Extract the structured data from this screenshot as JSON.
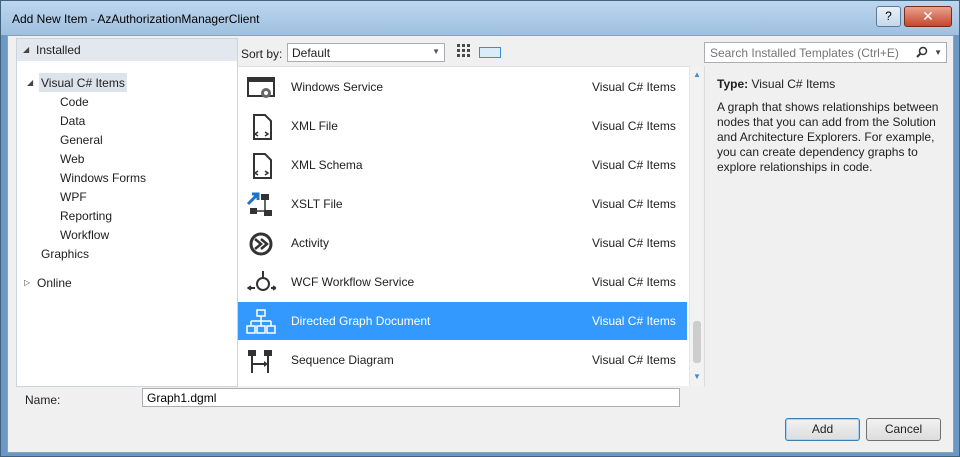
{
  "window": {
    "title": "Add New Item - AzAuthorizationManagerClient",
    "help_glyph": "?",
    "close_glyph": "✕"
  },
  "tree": {
    "installed": "Installed",
    "root": "Visual C# Items",
    "children": [
      "Code",
      "Data",
      "General",
      "Web",
      "Windows Forms",
      "WPF",
      "Reporting",
      "Workflow"
    ],
    "graphics": "Graphics",
    "online": "Online"
  },
  "sort": {
    "label": "Sort by:",
    "selected": "Default"
  },
  "search": {
    "placeholder": "Search Installed Templates (Ctrl+E)"
  },
  "templates": [
    {
      "name": "Windows Service",
      "category": "Visual C# Items",
      "icon": "windows-service-icon"
    },
    {
      "name": "XML File",
      "category": "Visual C# Items",
      "icon": "xml-file-icon"
    },
    {
      "name": "XML Schema",
      "category": "Visual C# Items",
      "icon": "xml-schema-icon"
    },
    {
      "name": "XSLT File",
      "category": "Visual C# Items",
      "icon": "xslt-file-icon"
    },
    {
      "name": "Activity",
      "category": "Visual C# Items",
      "icon": "activity-icon"
    },
    {
      "name": "WCF Workflow Service",
      "category": "Visual C# Items",
      "icon": "wcf-workflow-icon"
    },
    {
      "name": "Directed Graph Document",
      "category": "Visual C# Items",
      "icon": "directed-graph-icon",
      "selected": true
    },
    {
      "name": "Sequence Diagram",
      "category": "Visual C# Items",
      "icon": "sequence-diagram-icon"
    }
  ],
  "details": {
    "type_label": "Type:",
    "type_value": "Visual C# Items",
    "description": "A graph that shows relationships between nodes that you can add from the Solution and Architecture Explorers. For example, you can create dependency graphs to explore relationships in code."
  },
  "name_field": {
    "label": "Name:",
    "value": "Graph1.dgml"
  },
  "buttons": {
    "add": "Add",
    "cancel": "Cancel"
  },
  "colors": {
    "selection": "#3399ff",
    "accent": "#3b8dd4"
  }
}
